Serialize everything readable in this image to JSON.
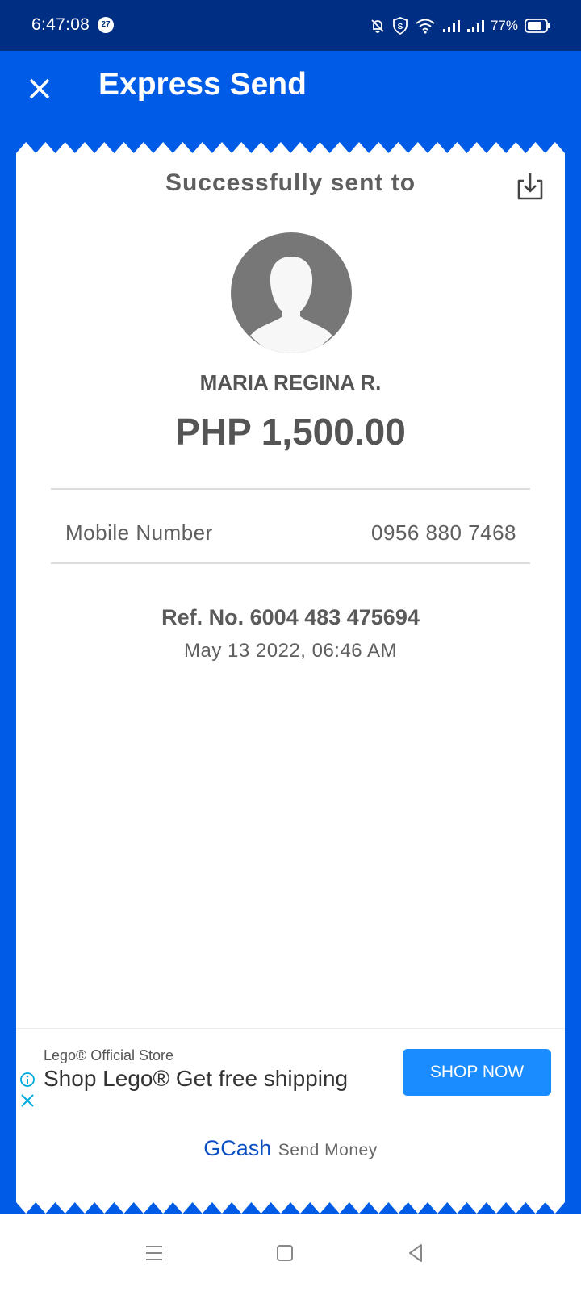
{
  "status_bar": {
    "time": "6:47:08",
    "notification_count": "27",
    "battery": "77%",
    "icons": [
      "mute-bell-icon",
      "shield-icon",
      "wifi-icon",
      "signal-icon",
      "signal-icon",
      "battery-icon"
    ]
  },
  "header": {
    "title": "Express Send",
    "close_icon": "close-icon"
  },
  "receipt": {
    "success_label": "Successfully sent to",
    "download_icon": "download-icon",
    "recipient_name": "MARIA REGINA R.",
    "amount": "PHP 1,500.00",
    "details": [
      {
        "label": "Mobile Number",
        "value": "0956 880 7468"
      }
    ],
    "reference_number": "Ref. No. 6004 483 475694",
    "date": "May 13 2022, 06:46 AM"
  },
  "ad": {
    "advertiser": "Lego® Official Store",
    "headline": "Shop Lego® Get free shipping",
    "cta_label": "SHOP NOW"
  },
  "footer": {
    "brand": "GCash",
    "subtitle": "Send Money"
  },
  "colors": {
    "brand_blue": "#005ce6",
    "status_bar": "#002e82",
    "ad_button": "#1a8cff",
    "logo_blue": "#0a4fc2"
  }
}
